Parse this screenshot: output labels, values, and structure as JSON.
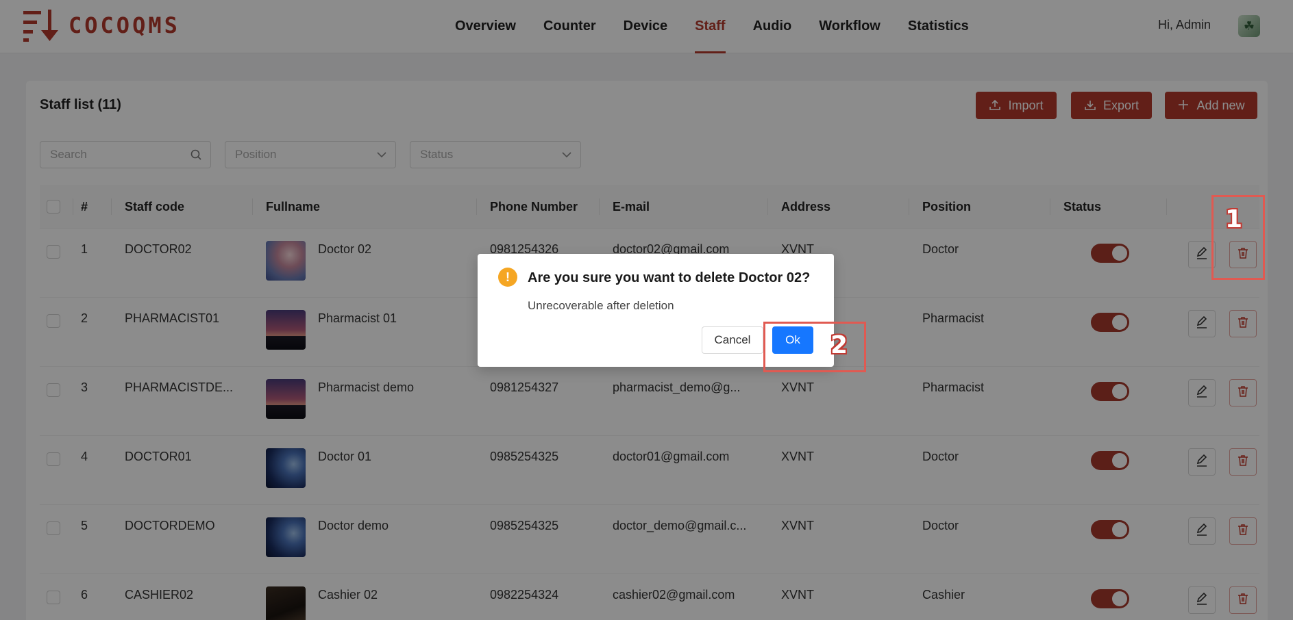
{
  "app": {
    "logo_text": "COCOQMS"
  },
  "nav": {
    "items": [
      {
        "label": "Overview",
        "active": false
      },
      {
        "label": "Counter",
        "active": false
      },
      {
        "label": "Device",
        "active": false
      },
      {
        "label": "Staff",
        "active": true
      },
      {
        "label": "Audio",
        "active": false
      },
      {
        "label": "Workflow",
        "active": false
      },
      {
        "label": "Statistics",
        "active": false
      }
    ],
    "greeting": "Hi, Admin"
  },
  "page": {
    "title": "Staff list (11)",
    "import_label": "Import",
    "export_label": "Export",
    "add_label": "Add new"
  },
  "filters": {
    "search_placeholder": "Search",
    "position_placeholder": "Position",
    "status_placeholder": "Status"
  },
  "table": {
    "headers": [
      "#",
      "Staff code",
      "Fullname",
      "Phone Number",
      "E-mail",
      "Address",
      "Position",
      "Status"
    ],
    "rows": [
      {
        "index": "1",
        "code": "DOCTOR02",
        "name": "Doctor 02",
        "phone": "0981254326",
        "email": "doctor02@gmail.com",
        "address": "XVNT",
        "position": "Doctor",
        "status_on": true
      },
      {
        "index": "2",
        "code": "PHARMACIST01",
        "name": "Pharmacist 01",
        "phone": "",
        "email": "",
        "address": "",
        "position": "Pharmacist",
        "status_on": true
      },
      {
        "index": "3",
        "code": "PHARMACISTDE...",
        "name": "Pharmacist demo",
        "phone": "0981254327",
        "email": "pharmacist_demo@g...",
        "address": "XVNT",
        "position": "Pharmacist",
        "status_on": true
      },
      {
        "index": "4",
        "code": "DOCTOR01",
        "name": "Doctor 01",
        "phone": "0985254325",
        "email": "doctor01@gmail.com",
        "address": "XVNT",
        "position": "Doctor",
        "status_on": true
      },
      {
        "index": "5",
        "code": "DOCTORDEMO",
        "name": "Doctor demo",
        "phone": "0985254325",
        "email": "doctor_demo@gmail.c...",
        "address": "XVNT",
        "position": "Doctor",
        "status_on": true
      },
      {
        "index": "6",
        "code": "CASHIER02",
        "name": "Cashier 02",
        "phone": "0982254324",
        "email": "cashier02@gmail.com",
        "address": "XVNT",
        "position": "Cashier",
        "status_on": true
      }
    ]
  },
  "modal": {
    "title": "Are you sure you want to delete Doctor 02?",
    "description": "Unrecoverable after deletion",
    "cancel_label": "Cancel",
    "ok_label": "Ok"
  },
  "annotations": {
    "step1": "1",
    "step2": "2"
  },
  "colors": {
    "brand": "#b3392c",
    "primary": "#1677ff",
    "warning": "#f5a623",
    "annotation": "#e05a52"
  },
  "icons": {
    "search": "search-icon",
    "chevron": "chevron-down-icon",
    "edit": "edit-icon",
    "delete": "trash-icon",
    "upload": "upload-icon",
    "download": "download-icon",
    "plus": "plus-icon",
    "warning": "exclamation-icon"
  }
}
